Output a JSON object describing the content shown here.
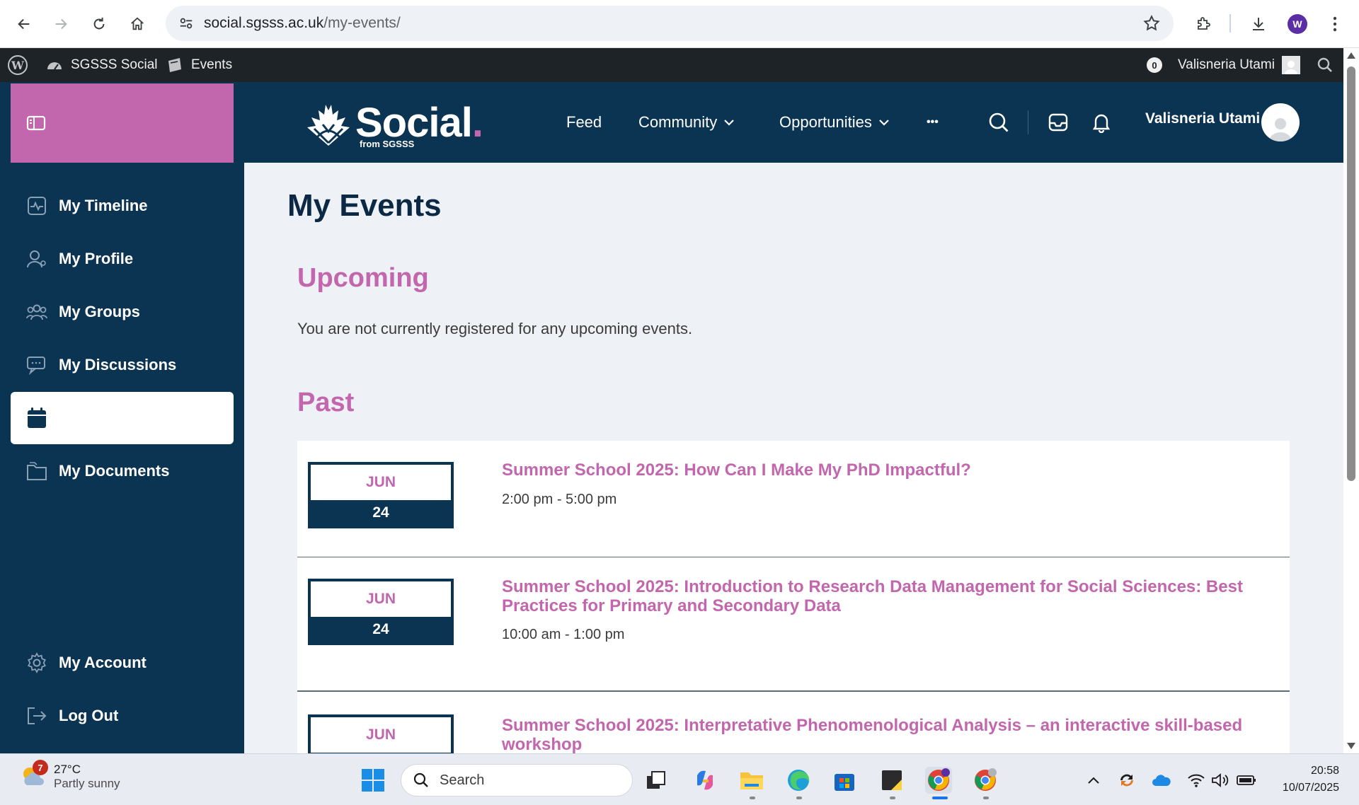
{
  "browser": {
    "url_host": "social.sgsss.ac.uk",
    "url_path": "/my-events/",
    "profile_initial": "W"
  },
  "adminbar": {
    "site_name": "SGSSS Social",
    "events_label": "Events",
    "notification_count": "0",
    "user_name": "Valisneria Utami"
  },
  "header": {
    "logo_text": "Social",
    "logo_dot": ".",
    "logo_sub": "from SGSSS",
    "nav": [
      {
        "label": "Feed"
      },
      {
        "label": "Community"
      },
      {
        "label": "Opportunities"
      }
    ],
    "more_label": "•••",
    "user_name": "Valisneria Utami"
  },
  "sidebar": {
    "items": [
      {
        "label": "My Timeline",
        "icon": "timeline-icon"
      },
      {
        "label": "My Profile",
        "icon": "profile-icon"
      },
      {
        "label": "My Groups",
        "icon": "groups-icon"
      },
      {
        "label": "My Discussions",
        "icon": "discussions-icon"
      },
      {
        "label": "",
        "icon": "calendar-icon"
      },
      {
        "label": "My Documents",
        "icon": "documents-icon"
      }
    ],
    "bottom": [
      {
        "label": "My Account",
        "icon": "gear-icon"
      },
      {
        "label": "Log Out",
        "icon": "logout-icon"
      }
    ]
  },
  "main": {
    "title": "My Events",
    "upcoming_heading": "Upcoming",
    "upcoming_empty": "You are not currently registered for any upcoming events.",
    "past_heading": "Past",
    "events": [
      {
        "month": "JUN",
        "day": "24",
        "title": "Summer School 2025: How Can I Make My PhD Impactful?",
        "time": "2:00 pm - 5:00 pm"
      },
      {
        "month": "JUN",
        "day": "24",
        "title": "Summer School 2025: Introduction to Research Data Management for Social Sciences: Best Practices for Primary and Secondary Data",
        "time": "10:00 am - 1:00 pm"
      },
      {
        "month": "JUN",
        "day": "",
        "title": "Summer School 2025: Interpretative Phenomenological Analysis – an interactive skill-based workshop",
        "time": ""
      }
    ]
  },
  "taskbar": {
    "weather_temp": "27°C",
    "weather_cond": "Partly sunny",
    "weather_badge": "7",
    "search_label": "Search",
    "time": "20:58",
    "date": "10/07/2025"
  },
  "colors": {
    "navy": "#0b3352",
    "pink": "#c266ad",
    "content_bg": "#eef2f6"
  }
}
